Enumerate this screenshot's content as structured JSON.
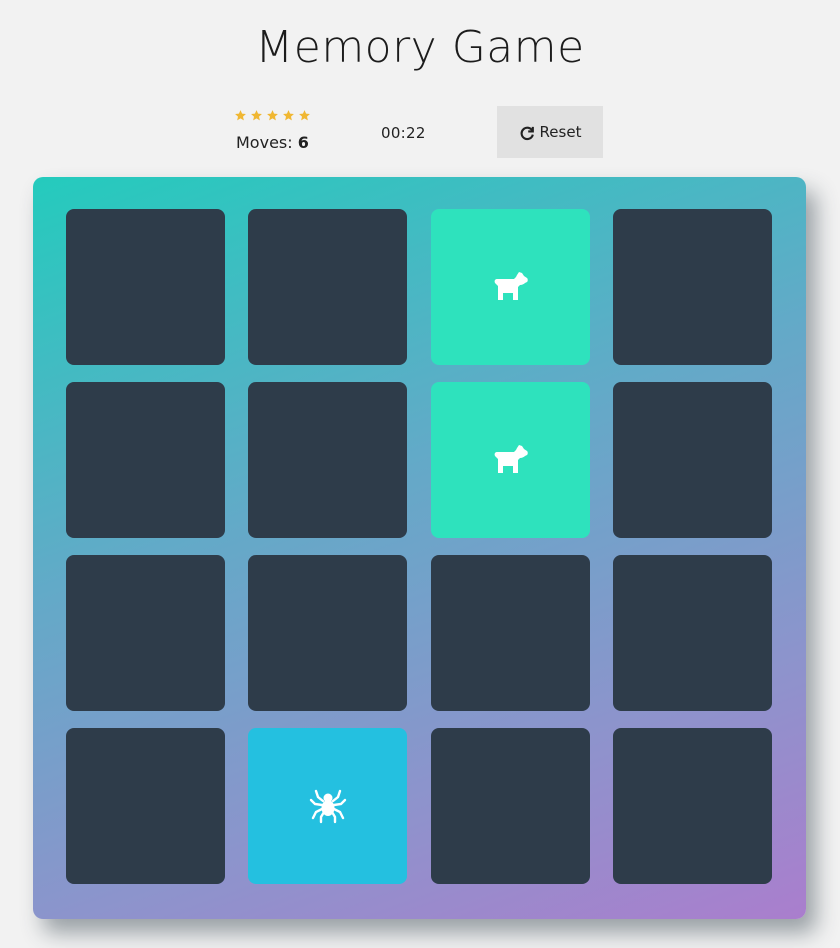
{
  "title": "Memory Game",
  "score": {
    "stars_total": 5,
    "stars_filled": 5,
    "star_color": "#f0b732",
    "moves_label": "Moves: ",
    "moves_value": "6",
    "timer": "00:22"
  },
  "reset": {
    "label": "Reset",
    "icon": "repeat-icon"
  },
  "colors": {
    "card_hidden": "#2e3c4a",
    "card_open": "#2ee2bd",
    "card_show": "#24c0e0",
    "deck_gradient": [
      "#24cbbd",
      "#64a9c8",
      "#8e93cc",
      "#aa7ecd"
    ]
  },
  "cards": [
    {
      "state": "hidden"
    },
    {
      "state": "hidden"
    },
    {
      "state": "open",
      "icon": "dog-icon"
    },
    {
      "state": "hidden"
    },
    {
      "state": "hidden"
    },
    {
      "state": "hidden"
    },
    {
      "state": "open",
      "icon": "dog-icon"
    },
    {
      "state": "hidden"
    },
    {
      "state": "hidden"
    },
    {
      "state": "hidden"
    },
    {
      "state": "hidden"
    },
    {
      "state": "hidden"
    },
    {
      "state": "hidden"
    },
    {
      "state": "show",
      "icon": "spider-icon"
    },
    {
      "state": "hidden"
    },
    {
      "state": "hidden"
    }
  ]
}
